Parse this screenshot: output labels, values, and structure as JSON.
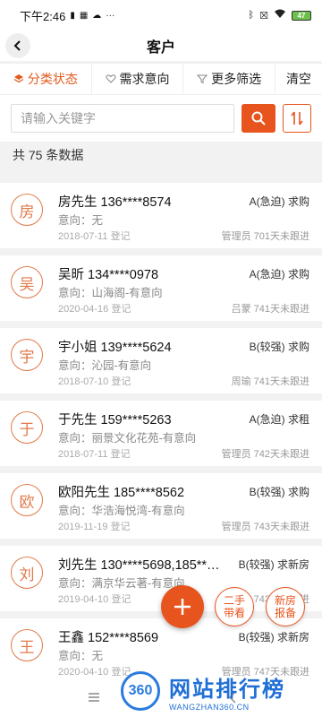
{
  "status_bar": {
    "time": "下午2:46",
    "battery": "47"
  },
  "nav": {
    "title": "客户"
  },
  "filters": {
    "category": "分类状态",
    "demand": "需求意向",
    "more": "更多筛选",
    "clear": "清空"
  },
  "search": {
    "placeholder": "请输入关键字"
  },
  "count_text": "共 75 条数据",
  "customers": [
    {
      "avatar": "房",
      "name": "房先生 136****8574",
      "grade": "A(急迫) 求购",
      "intent": "意向：无",
      "date": "2018-07-11 登记",
      "followup": "管理员  701天未跟进"
    },
    {
      "avatar": "吴",
      "name": "吴昕 134****0978",
      "grade": "A(急迫) 求购",
      "intent": "意向：山海阁-有意向",
      "date": "2020-04-16 登记",
      "followup": "吕蒙  741天未跟进"
    },
    {
      "avatar": "宇",
      "name": "宇小姐 139****5624",
      "grade": "B(较强) 求购",
      "intent": "意向：沁园-有意向",
      "date": "2018-07-10 登记",
      "followup": "周瑜  741天未跟进"
    },
    {
      "avatar": "于",
      "name": "于先生 159****5263",
      "grade": "A(急迫) 求租",
      "intent": "意向：丽景文化花苑-有意向",
      "date": "2018-07-11 登记",
      "followup": "管理员  742天未跟进"
    },
    {
      "avatar": "欧",
      "name": "欧阳先生 185****8562",
      "grade": "B(较强) 求购",
      "intent": "意向：华浩海悦湾-有意向",
      "date": "2019-11-19 登记",
      "followup": "管理员  743天未跟进"
    },
    {
      "avatar": "刘",
      "name": "刘先生 130****5698,185**…",
      "grade": "B(较强) 求新房",
      "intent": "意向：满京华云著-有意向",
      "date": "2019-04-10 登记",
      "followup": "743天未跟进"
    },
    {
      "avatar": "王",
      "name": "王鑫 152****8569",
      "grade": "B(较强) 求新房",
      "intent": "意向：无",
      "date": "2020-04-10 登记",
      "followup": "管理员  747天未跟进"
    }
  ],
  "fab": {
    "second_hand": "二手\n带看",
    "new_house": "新房\n报备"
  },
  "watermark": {
    "logo": "360",
    "title": "网站排行榜",
    "url": "WANGZHAN360.CN"
  },
  "colors": {
    "accent": "#e8541e",
    "avatar": "#e07a4a"
  }
}
